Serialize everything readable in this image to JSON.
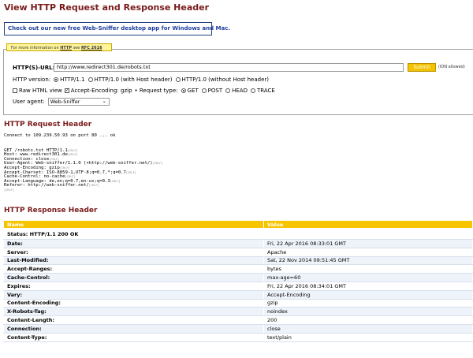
{
  "page": {
    "title": "View HTTP Request and Response Header"
  },
  "promo": {
    "text": "Check out our new free Web-Sniffer desktop app for Windows and Mac."
  },
  "info_bar": {
    "prefix": "For more information on ",
    "http": "HTTP",
    "see": " see ",
    "rfc": "RFC 2616"
  },
  "form": {
    "url_label": "HTTP(S)-URL:",
    "url_value": "http://www.redirect301.de/robots.txt",
    "submit_label": "Submit",
    "idn_note": "(IDN allowed)",
    "version_label": "HTTP version:",
    "versions": [
      "HTTP/1.1",
      "HTTP/1.0 (with Host header)",
      "HTTP/1.0 (without Host header)"
    ],
    "raw_html_label": "Raw HTML view",
    "accept_encoding_label": "Accept-Encoding: gzip",
    "request_type_label": "• Request type:",
    "request_types": [
      "GET",
      "POST",
      "HEAD",
      "TRACE"
    ],
    "user_agent_label": "User agent:",
    "user_agent_value": "Web-Sniffer"
  },
  "request": {
    "title": "HTTP Request Header",
    "connect": "Connect to 109.239.50.93 on port 80 ... ok",
    "lines": [
      "GET /robots.txt HTTP/1.1",
      "Host: www.redirect301.de",
      "Connection: close",
      "User-Agent: Web-sniffer/1.1.0 (+http://web-sniffer.net/)",
      "Accept-Encoding: gzip",
      "Accept-Charset: ISO-8859-1,UTF-8;q=0.7,*;q=0.7",
      "Cache-Control: no-cache",
      "Accept-Language: de,en;q=0.7,en-us;q=0.3",
      "Referer: http://web-sniffer.net/",
      ""
    ],
    "crlf": "[CRLF]"
  },
  "response": {
    "title": "HTTP Response Header",
    "col_name": "Name",
    "col_value": "Value",
    "status": "Status: HTTP/1.1 200 OK",
    "rows": [
      {
        "name": "Date:",
        "value": "Fri, 22 Apr 2016 08:33:01 GMT"
      },
      {
        "name": "Server:",
        "value": "Apache"
      },
      {
        "name": "Last-Modified:",
        "value": "Sat, 22 Nov 2014 09:51:45 GMT"
      },
      {
        "name": "Accept-Ranges:",
        "value": "bytes"
      },
      {
        "name": "Cache-Control:",
        "value": "max-age=60"
      },
      {
        "name": "Expires:",
        "value": "Fri, 22 Apr 2016 08:34:01 GMT"
      },
      {
        "name": "Vary:",
        "value": "Accept-Encoding"
      },
      {
        "name": "Content-Encoding:",
        "value": "gzip"
      },
      {
        "name": "X-Robots-Tag:",
        "value": "noindex"
      },
      {
        "name": "Content-Length:",
        "value": "200"
      },
      {
        "name": "Connection:",
        "value": "close"
      },
      {
        "name": "Content-Type:",
        "value": "text/plain"
      }
    ]
  },
  "colors": {
    "title": "#7a1a1a",
    "accent": "#f7c500",
    "link": "#1f3f9f"
  }
}
